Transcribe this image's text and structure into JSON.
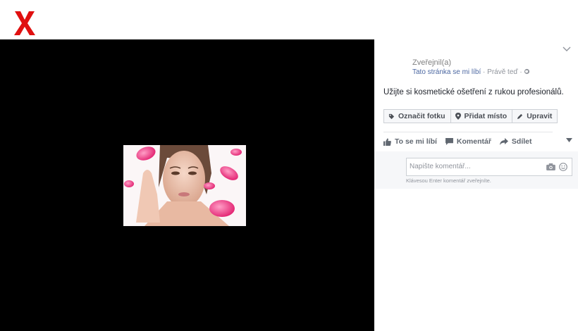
{
  "close": {
    "icon": "close-x-icon",
    "color": "#e01010"
  },
  "photo": {
    "description_icon": "photo-image"
  },
  "post": {
    "poster_label": "Zveřejnil(a)",
    "page_like": "Tato stránka se mi líbí",
    "meta_sep": " · ",
    "time": "Právě teď",
    "meta_tail": " · ",
    "text": "Užijte si kosmetické ošetření z rukou profesionálů."
  },
  "buttons": {
    "tag": "Označit fotku",
    "place": "Přidat místo",
    "edit": "Upravit"
  },
  "actions": {
    "like": "To se mi líbí",
    "comment": "Komentář",
    "share": "Sdílet"
  },
  "comment": {
    "placeholder": "Napište komentář...",
    "hint": "Klávesou Enter komentář zveřejníte."
  },
  "colors": {
    "link": "#4b67a1",
    "overlay": "#000000"
  }
}
